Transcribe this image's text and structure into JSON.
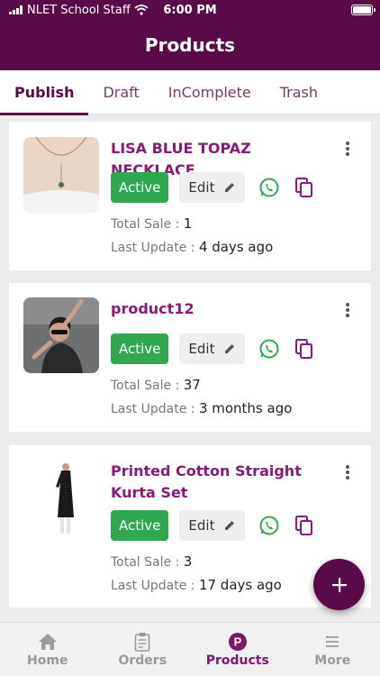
{
  "status": {
    "carrier": "NLET School Staff",
    "time": "6:00 PM"
  },
  "header": {
    "title": "Products"
  },
  "tabs": [
    {
      "label": "Publish",
      "active": true
    },
    {
      "label": "Draft",
      "active": false
    },
    {
      "label": "InComplete",
      "active": false
    },
    {
      "label": "Trash",
      "active": false
    }
  ],
  "products": [
    {
      "name": "LISA BLUE TOPAZ NECKLACE",
      "status": "Active",
      "edit": "Edit",
      "total_sale_label": "Total Sale :",
      "total_sale": "1",
      "last_update_label": "Last Update :",
      "last_update": "4 days ago"
    },
    {
      "name": "product12",
      "status": "Active",
      "edit": "Edit",
      "total_sale_label": "Total Sale :",
      "total_sale": "37",
      "last_update_label": "Last Update :",
      "last_update": "3 months ago"
    },
    {
      "name": "Printed Cotton Straight Kurta Set",
      "status": "Active",
      "edit": "Edit",
      "total_sale_label": "Total Sale :",
      "total_sale": "3",
      "last_update_label": "Last Update :",
      "last_update": "17 days ago"
    }
  ],
  "bottom_nav": [
    {
      "label": "Home",
      "icon": "home-icon",
      "active": false
    },
    {
      "label": "Orders",
      "icon": "clipboard-icon",
      "active": false
    },
    {
      "label": "Products",
      "icon": "product-p-icon",
      "active": true
    },
    {
      "label": "More",
      "icon": "menu-icon",
      "active": false
    }
  ],
  "colors": {
    "primary": "#5b0a48",
    "active_green": "#2fa84f",
    "whatsapp": "#2fa84f",
    "product_name": "#8a1a78"
  }
}
